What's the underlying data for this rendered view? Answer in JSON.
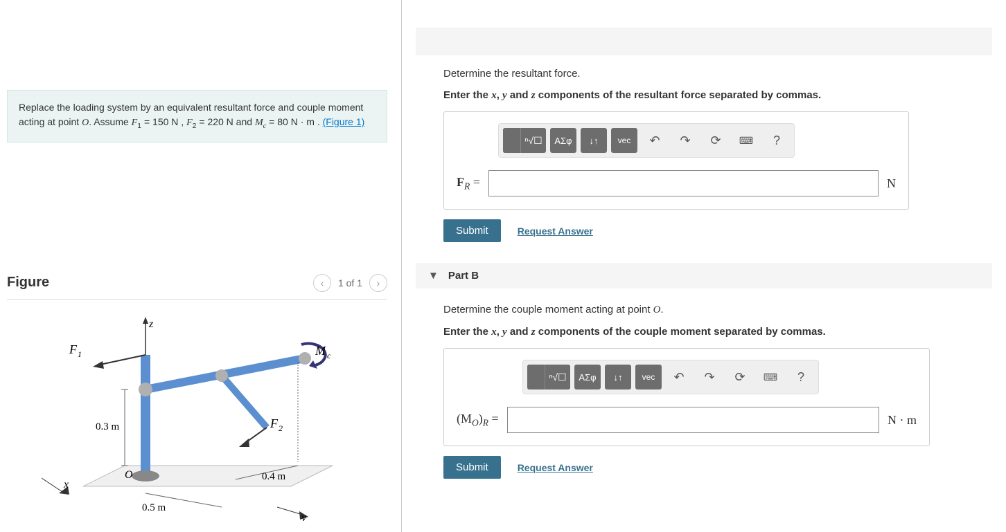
{
  "problem": {
    "prefix": "Replace the loading system by an equivalent resultant force and couple moment acting at point ",
    "pointO": "O",
    "assume": ". Assume ",
    "F1sym": "F",
    "F1sub": "1",
    "eq": " = ",
    "F1val": "150 N",
    "sep": " , ",
    "F2sym": "F",
    "F2sub": "2",
    "F2val": "220 N",
    "and": " and ",
    "Mcsym": "M",
    "Mcsub": "c",
    "Mcval": "80 N · m",
    "period": " . ",
    "figref": "(Figure 1)"
  },
  "figure": {
    "title": "Figure",
    "pager": "1 of 1",
    "labels": {
      "z": "z",
      "x": "x",
      "y": "y",
      "O": "O",
      "F1": "F₁",
      "F2": "F₂",
      "Mc": "Mc",
      "d03": "0.3 m",
      "d05": "0.5 m",
      "d04": "0.4 m"
    }
  },
  "partA": {
    "q1": "Determine the resultant force.",
    "q2_pre": "Enter the ",
    "q2_x": "x",
    "q2_sep1": ", ",
    "q2_y": "y",
    "q2_and": " and ",
    "q2_z": "z",
    "q2_post": " components of the resultant force separated by commas.",
    "lhs_pre": "F",
    "lhs_sub": "R",
    "lhs_eq": " = ",
    "unit": "N",
    "submit": "Submit",
    "request": "Request Answer"
  },
  "partB": {
    "title": "Part B",
    "q1_pre": "Determine the couple moment acting at point ",
    "q1_O": "O",
    "q1_post": ".",
    "q2_pre": "Enter the ",
    "q2_x": "x",
    "q2_sep1": ", ",
    "q2_y": "y",
    "q2_and": " and ",
    "q2_z": "z",
    "q2_post": " components of the couple moment separated by commas.",
    "lhs": "(M",
    "lhs_sub1": "O",
    "lhs_mid": ")",
    "lhs_sub2": "R",
    "lhs_eq": " = ",
    "unit": "N · m",
    "submit": "Submit",
    "request": "Request Answer"
  },
  "toolbar": {
    "greek": "ΑΣφ",
    "vec": "vec",
    "updown": "↓↑",
    "root": "ⁿ√☐",
    "undo": "↶",
    "redo": "↷",
    "reset": "⟳",
    "keyboard": "⌨",
    "help": "?"
  }
}
